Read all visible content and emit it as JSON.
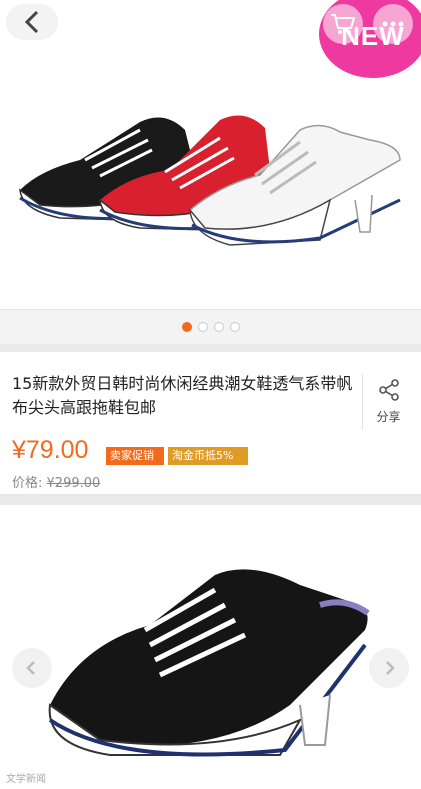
{
  "hero": {
    "badge_text": "NEW"
  },
  "carousel": {
    "active_index": 0,
    "count": 4
  },
  "product": {
    "title": "15新款外贸日韩时尚休闲经典潮女鞋透气系带帆布尖头高跟拖鞋包邮",
    "share_label": "分享",
    "price": "¥79.00",
    "tags": [
      "卖家促销",
      "淘金币抵5%"
    ],
    "original_price_label": "价格:",
    "original_price": "¥299.00"
  },
  "footer": {
    "watermark": "文学新闻"
  },
  "colors": {
    "accent": "#f26a1b",
    "badge": "#ee3aa0"
  }
}
